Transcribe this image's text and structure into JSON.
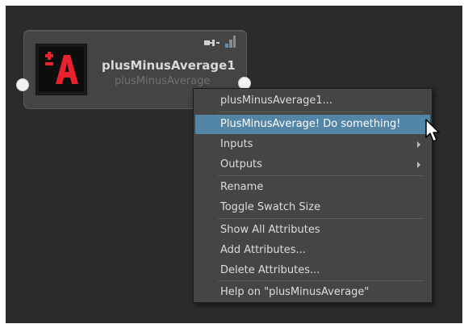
{
  "node": {
    "name": "plusMinusAverage1",
    "type": "plusMinusAverage",
    "swatch_label": "±A"
  },
  "context_menu": {
    "items": [
      {
        "label": "plusMinusAverage1...",
        "highlighted": false,
        "submenu": false
      },
      {
        "label": "PlusMinusAverage! Do something!",
        "highlighted": true,
        "submenu": false
      },
      {
        "label": "Inputs",
        "highlighted": false,
        "submenu": true
      },
      {
        "label": "Outputs",
        "highlighted": false,
        "submenu": true
      },
      {
        "label": "Rename",
        "highlighted": false,
        "submenu": false
      },
      {
        "label": "Toggle Swatch Size",
        "highlighted": false,
        "submenu": false
      },
      {
        "label": "Show All Attributes",
        "highlighted": false,
        "submenu": false
      },
      {
        "label": "Add Attributes...",
        "highlighted": false,
        "submenu": false
      },
      {
        "label": "Delete Attributes...",
        "highlighted": false,
        "submenu": false
      },
      {
        "label": "Help on \"plusMinusAverage\"",
        "highlighted": false,
        "submenu": false
      }
    ]
  },
  "icons": [
    "plus-minus-average-swatch-icon",
    "node-options-icon",
    "node-size-icon",
    "mouse-cursor-icon",
    "submenu-arrow-icon"
  ],
  "colors": {
    "canvas_bg": "#2b2b2b",
    "node_bg": "#444444",
    "menu_bg": "#454545",
    "highlight": "#5285a6",
    "swatch_red": "#e8212e"
  }
}
